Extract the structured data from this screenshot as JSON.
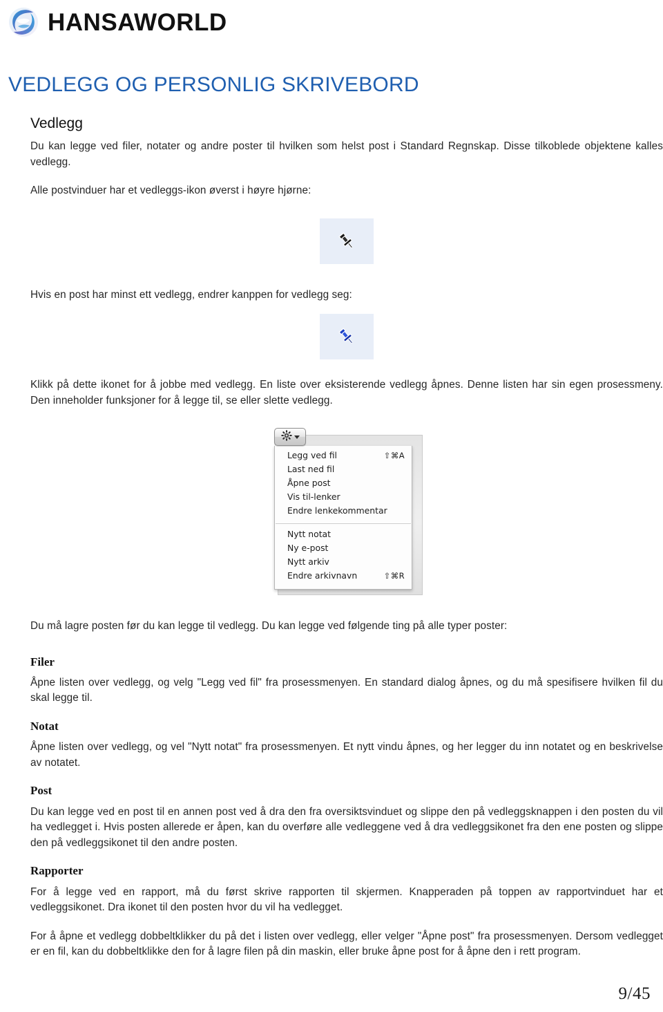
{
  "brand": {
    "name": "HANSAWORLD",
    "logo_icon": "hansaworld-swirl-logo"
  },
  "page_title": "VEDLEGG OG PERSONLIG SKRIVEBORD",
  "sections": {
    "vedlegg_heading": "Vedlegg",
    "p1": "Du kan legge ved filer, notater og andre poster til hvilken som helst post i Standard Regnskap. Disse tilkoblede objektene kalles vedlegg.",
    "p2": "Alle postvinduer har et vedleggs-ikon øverst i høyre hjørne:",
    "p3": "Hvis en post har minst ett vedlegg, endrer kanppen for vedlegg seg:",
    "p4": "Klikk på dette ikonet for å jobbe med vedlegg. En liste over eksisterende vedlegg åpnes. Denne listen har sin egen prosessmeny. Den inneholder funksjoner for å legge til, se eller slette vedlegg.",
    "p5": "Du må lagre posten før du kan legge til vedlegg. Du kan legge ved følgende ting på alle typer poster:",
    "filer_heading": "Filer",
    "filer_body": "Åpne listen over vedlegg, og velg \"Legg ved fil\" fra prosessmenyen. En standard dialog åpnes, og du må spesifisere hvilken fil du skal legge til.",
    "notat_heading": "Notat",
    "notat_body": "Åpne listen over vedlegg, og vel \"Nytt notat\" fra prosessmenyen. Et nytt vindu åpnes, og her legger du inn notatet og  en beskrivelse av notatet.",
    "post_heading": "Post",
    "post_body": "Du kan legge ved en post til en annen post ved å dra den fra oversiktsvinduet og slippe den på vedleggsknappen i den posten du vil ha vedlegget i. Hvis posten allerede er åpen, kan du overføre alle vedleggene ved å dra vedleggsikonet fra den ene posten og slippe den på vedleggsikonet til den andre posten.",
    "rapporter_heading": "Rapporter",
    "rapporter_body1": "For å legge ved en rapport, må du først skrive rapporten til skjermen. Knapperaden på toppen av rapportvinduet har et vedleggsikonet. Dra ikonet til den posten hvor du vil ha vedlegget.",
    "rapporter_body2": "For å åpne et vedlegg dobbeltklikker du på det i listen over vedlegg, eller velger \"Åpne post\" fra prosessmenyen. Dersom vedlegget er en fil, kan du dobbeltklikke den for å lagre filen på din maskin, eller bruke åpne post for å åpne den i rett program."
  },
  "icons": {
    "pin_empty": "pushpin-black-icon",
    "pin_filled": "pushpin-blue-icon",
    "gear": "gear-icon",
    "caret": "chevron-down-icon"
  },
  "process_menu": {
    "button_label": "",
    "group1": [
      {
        "label": "Legg ved fil",
        "shortcut": "⇧⌘A"
      },
      {
        "label": "Last ned fil",
        "shortcut": ""
      },
      {
        "label": "Åpne post",
        "shortcut": ""
      },
      {
        "label": "Vis til-lenker",
        "shortcut": ""
      },
      {
        "label": "Endre lenkekommentar",
        "shortcut": ""
      }
    ],
    "group2": [
      {
        "label": "Nytt notat",
        "shortcut": ""
      },
      {
        "label": "Ny e-post",
        "shortcut": ""
      },
      {
        "label": "Nytt arkiv",
        "shortcut": ""
      },
      {
        "label": "Endre arkivnavn",
        "shortcut": "⇧⌘R"
      }
    ]
  },
  "footer": {
    "page_number": "9/45"
  },
  "colors": {
    "title_blue": "#1f5fb0",
    "icon_tile_bg": "#e8eef8",
    "pin_blue": "#1b3fc4"
  }
}
